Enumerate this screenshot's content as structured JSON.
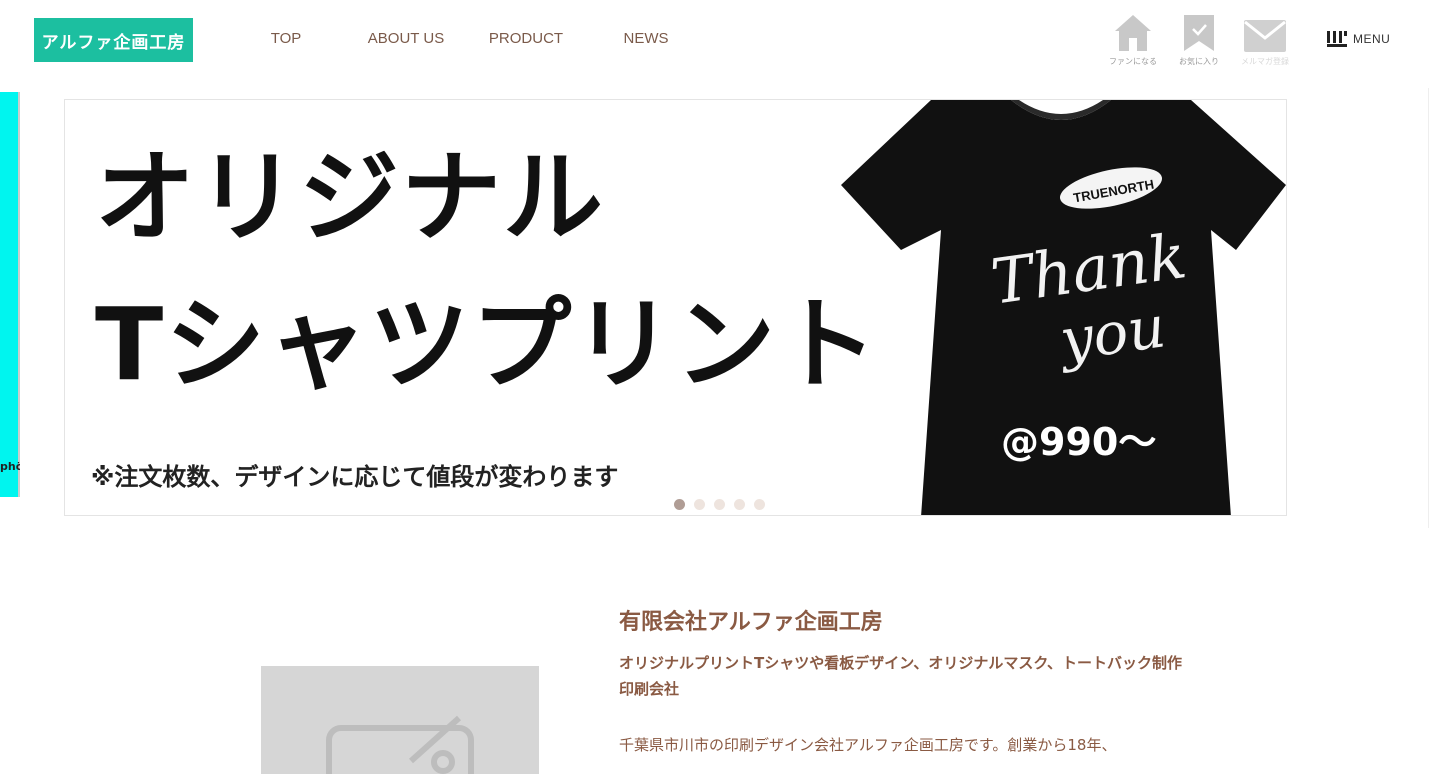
{
  "header": {
    "logo_text": "アルファ企画工房",
    "nav": [
      "TOP",
      "ABOUT US",
      "PRODUCT",
      "NEWS"
    ],
    "icons": [
      {
        "name": "home-icon",
        "label": "ファンになる"
      },
      {
        "name": "bookmark-icon",
        "label": "お気に入り"
      },
      {
        "name": "mail-icon",
        "label": "メルマガ登録"
      }
    ],
    "menu_label": "MENU"
  },
  "slider": {
    "headline_1": "オリジナル",
    "headline_2": "Tシャツプリント",
    "note": "※注文枚数、デザインに応じて値段が変わります",
    "shirt_brand": "TRUENORTH",
    "shirt_text_1": "Thank",
    "shirt_text_2": "you",
    "price": "@990～",
    "peek_text": "phö",
    "slide_count": 5,
    "active_index": 0
  },
  "about": {
    "company_name": "有限会社アルファ企画工房",
    "tagline": "オリジナルプリントTシャツや看板デザイン、オリジナルマスク、トートバック制作印刷会社",
    "description": "千葉県市川市の印刷デザイン会社アルファ企画工房です。創業から18年、"
  },
  "colors": {
    "brand": "#1cbfa0",
    "nav_text": "#7a5a4a",
    "accent_text": "#8a5a43",
    "peek_cyan": "#00f5ef"
  }
}
